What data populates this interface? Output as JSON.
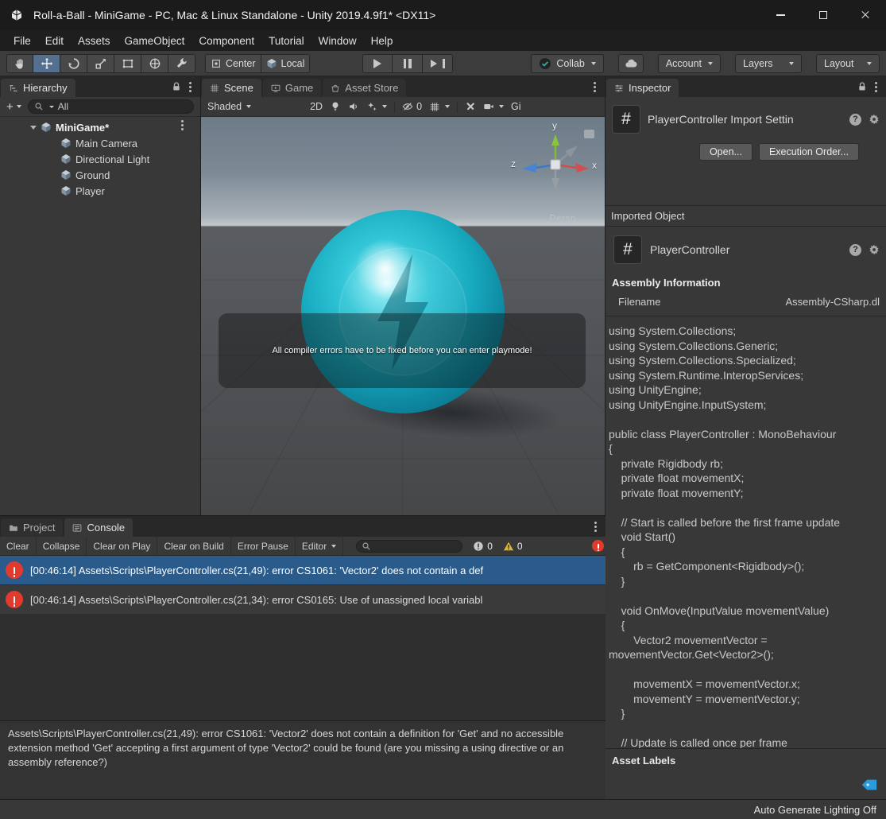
{
  "window": {
    "title": "Roll-a-Ball - MiniGame - PC, Mac & Linux Standalone - Unity 2019.4.9f1* <DX11>"
  },
  "menubar": {
    "items": [
      "File",
      "Edit",
      "Assets",
      "GameObject",
      "Component",
      "Tutorial",
      "Window",
      "Help"
    ]
  },
  "toolbar": {
    "pivot": "Center",
    "space": "Local",
    "collab": "Collab",
    "account": "Account",
    "layers": "Layers",
    "layout": "Layout"
  },
  "hierarchy": {
    "tab": "Hierarchy",
    "create_button": "+",
    "search_value": "All",
    "scene_name": "MiniGame*",
    "items": [
      "Main Camera",
      "Directional Light",
      "Ground",
      "Player"
    ]
  },
  "scene_view": {
    "tabs": {
      "scene": "Scene",
      "game": "Game",
      "asset_store": "Asset Store"
    },
    "toolbar": {
      "shading": "Shaded",
      "mode_2d": "2D",
      "visibility_count": "0",
      "gizmos": "Gi"
    },
    "overlay_message": "All compiler errors have to be fixed before you can enter playmode!",
    "gizmo": {
      "x": "x",
      "y": "y",
      "z": "z",
      "projection": "Persp"
    }
  },
  "console": {
    "project_tab": "Project",
    "console_tab": "Console",
    "toolbar": {
      "clear": "Clear",
      "collapse": "Collapse",
      "clear_on_play": "Clear on Play",
      "clear_on_build": "Clear on Build",
      "error_pause": "Error Pause",
      "editor": "Editor",
      "info_count": "0",
      "warning_count": "0"
    },
    "entries": [
      {
        "text": "[00:46:14] Assets\\Scripts\\PlayerController.cs(21,49): error CS1061: 'Vector2' does not contain a def"
      },
      {
        "text": "[00:46:14] Assets\\Scripts\\PlayerController.cs(21,34): error CS0165: Use of unassigned local variabl"
      }
    ],
    "detail": "Assets\\Scripts\\PlayerController.cs(21,49): error CS1061: 'Vector2' does not contain a definition for 'Get' and no accessible extension method 'Get' accepting a first argument of type 'Vector2' could be found (are you missing a using directive or an assembly reference?)"
  },
  "inspector": {
    "tab": "Inspector",
    "header_title": "PlayerController Import Settin",
    "open_button": "Open...",
    "execution_order_button": "Execution Order...",
    "imported_object": "Imported Object",
    "script_title": "PlayerController",
    "assembly_information": "Assembly Information",
    "filename_label": "Filename",
    "filename_value": "Assembly-CSharp.dl",
    "code": "using System.Collections;\nusing System.Collections.Generic;\nusing System.Collections.Specialized;\nusing System.Runtime.InteropServices;\nusing UnityEngine;\nusing UnityEngine.InputSystem;\n\npublic class PlayerController : MonoBehaviour\n{\n    private Rigidbody rb;\n    private float movementX;\n    private float movementY;\n\n    // Start is called before the first frame update\n    void Start()\n    {\n        rb = GetComponent<Rigidbody>();\n    }\n\n    void OnMove(InputValue movementValue)\n    {\n        Vector2 movementVector = movementVector.Get<Vector2>();\n\n        movementX = movementVector.x;\n        movementY = movementVector.y;\n    }\n\n    // Update is called once per frame",
    "asset_labels": "Asset Labels"
  },
  "statusbar": {
    "right_text": "Auto Generate Lighting Off"
  },
  "icons": {
    "csharp": "#"
  },
  "colors": {
    "selection_blue": "#2a5b8a",
    "error_red": "#e23b2e",
    "sphere_teal": "#18abc0",
    "tag_blue": "#2a9bdc"
  }
}
